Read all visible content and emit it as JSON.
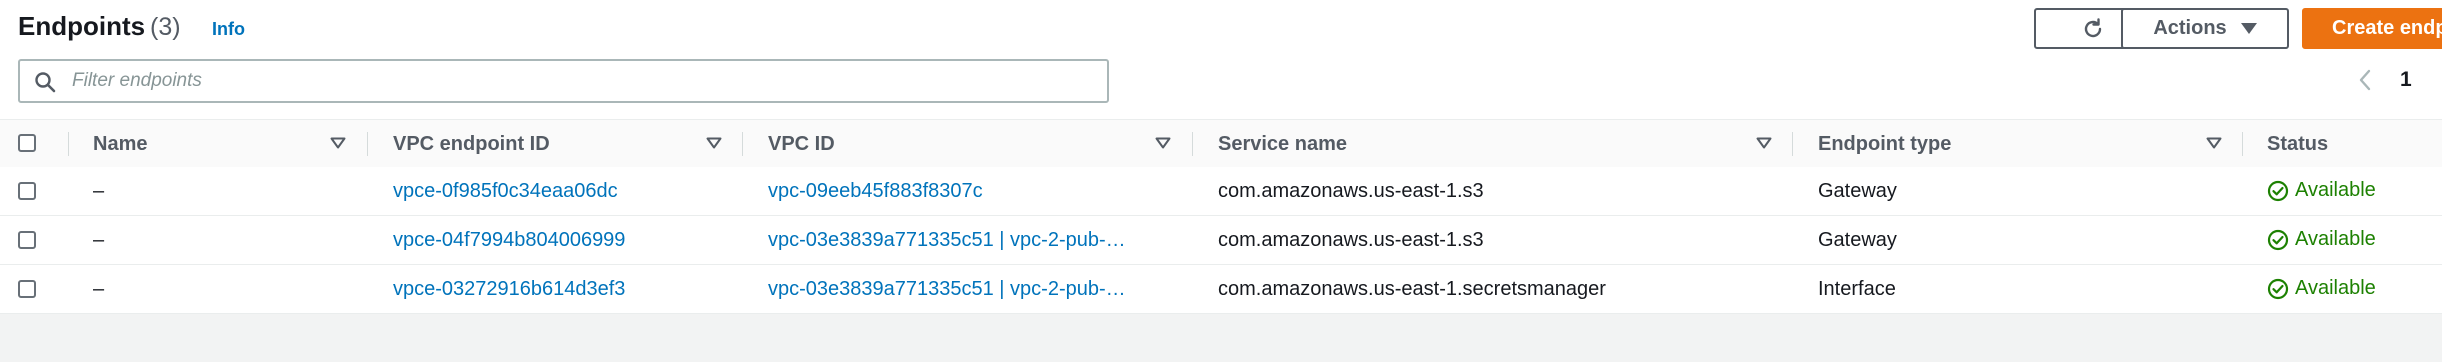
{
  "header": {
    "title": "Endpoints",
    "count": "(3)",
    "info_label": "Info"
  },
  "toolbar": {
    "refresh_icon": "refresh-icon",
    "actions_label": "Actions",
    "create_label": "Create endpoint"
  },
  "search": {
    "placeholder": "Filter endpoints",
    "value": ""
  },
  "pagination": {
    "current_page": "1"
  },
  "table": {
    "columns": [
      "Name",
      "VPC endpoint ID",
      "VPC ID",
      "Service name",
      "Endpoint type",
      "Status"
    ],
    "rows": [
      {
        "name": "–",
        "endpoint_id": "vpce-0f985f0c34eaa06dc",
        "vpc_id": "vpc-09eeb45f883f8307c",
        "service_name": "com.amazonaws.us-east-1.s3",
        "endpoint_type": "Gateway",
        "status": "Available"
      },
      {
        "name": "–",
        "endpoint_id": "vpce-04f7994b804006999",
        "vpc_id": "vpc-03e3839a771335c51 | vpc-2-pub-…",
        "service_name": "com.amazonaws.us-east-1.s3",
        "endpoint_type": "Gateway",
        "status": "Available"
      },
      {
        "name": "–",
        "endpoint_id": "vpce-03272916b614d3ef3",
        "vpc_id": "vpc-03e3839a771335c51 | vpc-2-pub-…",
        "service_name": "com.amazonaws.us-east-1.secretsmanager",
        "endpoint_type": "Interface",
        "status": "Available"
      }
    ]
  },
  "colors": {
    "link": "#0073bb",
    "status_available": "#1d8102",
    "primary_button": "#ec7211"
  }
}
